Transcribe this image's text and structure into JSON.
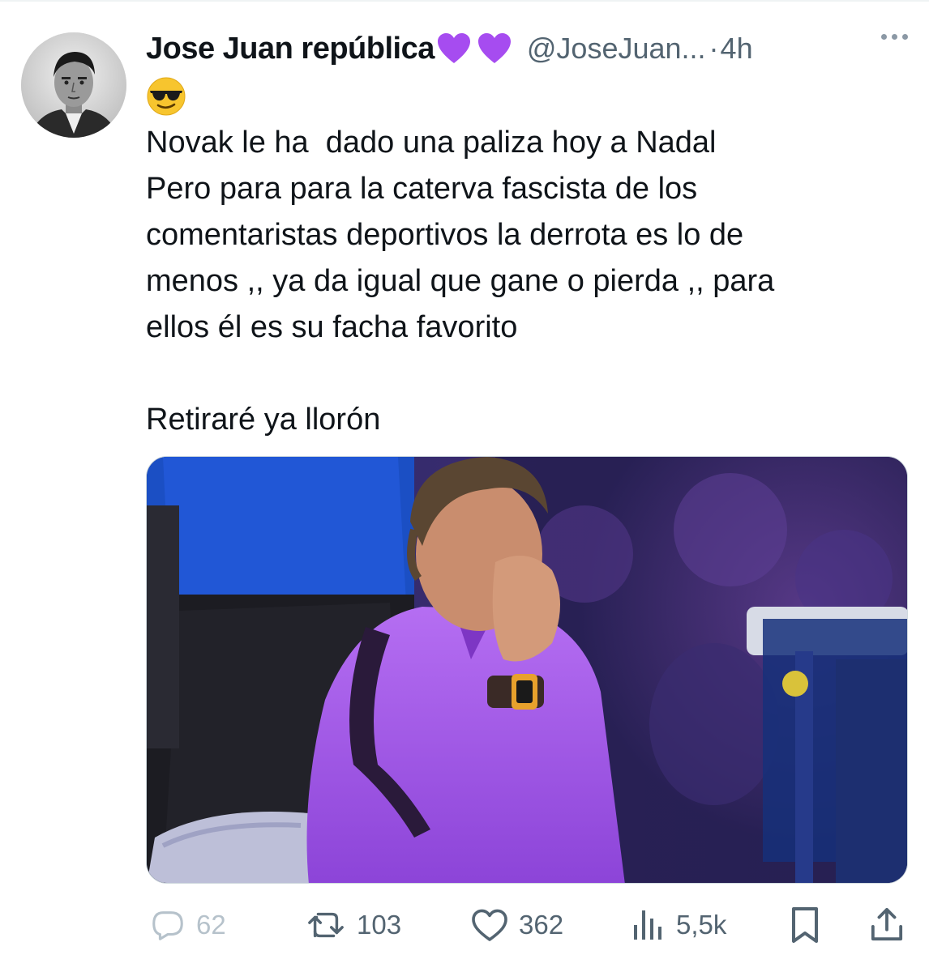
{
  "author": {
    "display_name": "Jose Juan república",
    "name_emojis": [
      "purple-heart",
      "purple-heart"
    ],
    "handle": "@JoseJuan...",
    "separator": "·",
    "time": "4h",
    "avatar": "avatar"
  },
  "tweet": {
    "leading_emoji": "smiling-face-with-sunglasses",
    "lines": [
      "Novak le ha  dado una paliza hoy a Nadal",
      "Pero para para la caterva fascista de los",
      "comentaristas deportivos la derrota es lo de",
      "menos ,, ya da igual que gane o pierda ,, para",
      "ellos él es su facha favorito"
    ],
    "last_line": "Retiraré ya llorón",
    "media": "tennis-player-photo"
  },
  "actions": {
    "reply": {
      "icon": "reply-icon",
      "count": "62"
    },
    "retweet": {
      "icon": "retweet-icon",
      "count": "103"
    },
    "like": {
      "icon": "heart-icon",
      "count": "362"
    },
    "views": {
      "icon": "views-icon",
      "count": "5,5k"
    },
    "bookmark": {
      "icon": "bookmark-icon"
    },
    "share": {
      "icon": "share-icon"
    }
  },
  "colors": {
    "text": "#0f1419",
    "secondary": "#536471",
    "heart_emoji": "#a64cf0",
    "jacket": "#a155e8"
  }
}
